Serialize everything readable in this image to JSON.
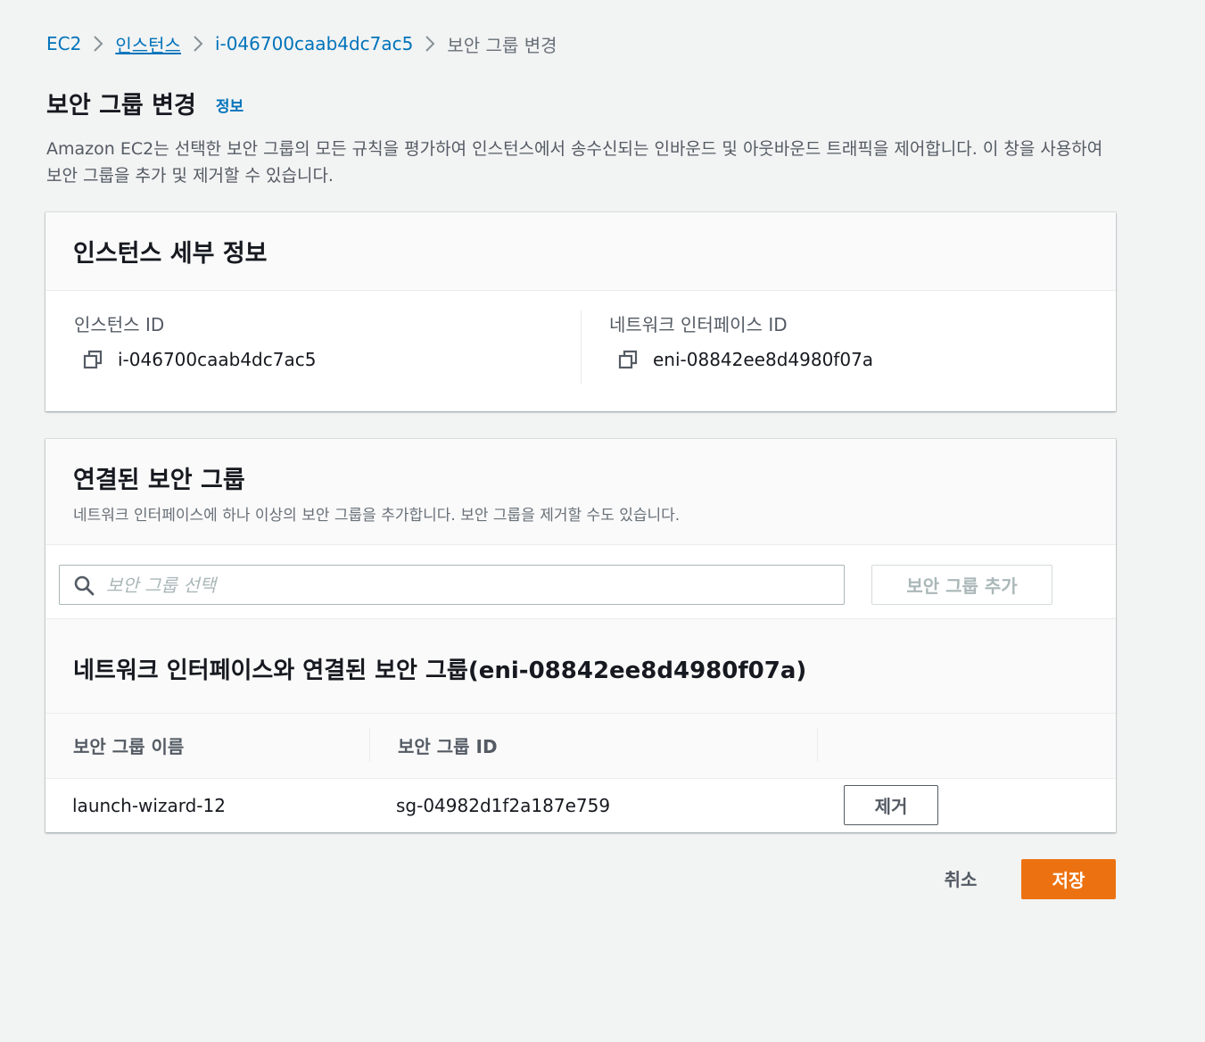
{
  "breadcrumb": {
    "items": [
      {
        "label": "EC2"
      },
      {
        "label": "인스턴스"
      },
      {
        "label": "i-046700caab4dc7ac5"
      },
      {
        "label": "보안 그룹 변경"
      }
    ]
  },
  "header": {
    "title": "보안 그룹 변경",
    "info_link": "정보",
    "description": "Amazon EC2는 선택한 보안 그룹의 모든 규칙을 평가하여 인스턴스에서 송수신되는 인바운드 및 아웃바운드 트래픽을 제어합니다. 이 창을 사용하여 보안 그룹을 추가 및 제거할 수 있습니다."
  },
  "instance_details": {
    "title": "인스턴스 세부 정보",
    "instance_id_label": "인스턴스 ID",
    "instance_id": "i-046700caab4dc7ac5",
    "eni_label": "네트워크 인터페이스 ID",
    "eni_id": "eni-08842ee8d4980f07a"
  },
  "security_groups": {
    "title": "연결된 보안 그룹",
    "description": "네트워크 인터페이스에 하나 이상의 보안 그룹을 추가합니다. 보안 그룹을 제거할 수도 있습니다.",
    "search_placeholder": "보안 그룹 선택",
    "add_button": "보안 그룹 추가",
    "table_title": "네트워크 인터페이스와 연결된 보안 그룹(eni-08842ee8d4980f07a)",
    "columns": [
      "보안 그룹 이름",
      "보안 그룹 ID"
    ],
    "rows": [
      {
        "name": "launch-wizard-12",
        "id": "sg-04982d1f2a187e759",
        "action": "제거"
      }
    ]
  },
  "footer": {
    "cancel": "취소",
    "save": "저장"
  },
  "colors": {
    "link": "#0073bb",
    "primary": "#ec7211",
    "background": "#f2f3f3"
  }
}
